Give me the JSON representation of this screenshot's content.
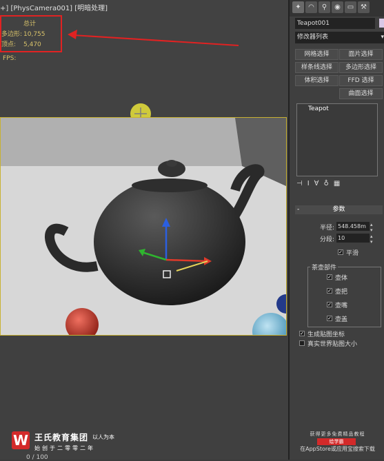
{
  "viewport": {
    "label": "+] [PhysCamera001] [明暗处理]",
    "stats": {
      "header": "总计",
      "polygons_label": "多边形:",
      "polygons_value": "10,755",
      "vertices_label": "顶点:",
      "vertices_value": "5,470"
    },
    "fps_label": "FPS:"
  },
  "branding": {
    "logo_letter": "W",
    "company": "王氏教育集团",
    "slogan": "以人为本",
    "founded": "始创于二零零二年",
    "page_counter": "0 / 100"
  },
  "panel": {
    "tabs": [
      "✦",
      "◠",
      "⚲",
      "◉",
      "▭",
      "⚒"
    ],
    "object_name": "Teapot001",
    "modifier_list": "修改器列表",
    "buttons": [
      "网格选择",
      "面片选择",
      "样条线选择",
      "多边形选择",
      "体积选择",
      "FFD 选择",
      "曲面选择"
    ],
    "stack_item": "Teapot",
    "stack_tools": [
      "⊣",
      "I",
      "∀",
      "♁",
      "▦"
    ],
    "rollout_title": "参数",
    "radius_label": "半径:",
    "radius_value": "548.458m",
    "segments_label": "分段:",
    "segments_value": "10",
    "smooth_label": "平滑",
    "parts_title": "茶壶部件",
    "parts": [
      "壶体",
      "壶把",
      "壶嘴",
      "壶盖"
    ],
    "gen_mapping_label": "生成贴图坐标",
    "real_world_label": "真实世界贴图大小"
  },
  "promo": {
    "line1": "获得更多免费精品教程",
    "badge": "绘学霸",
    "line2": "在AppStore或应用宝搜索下载"
  },
  "colors": {
    "annotation": "#e12222",
    "stats_text": "#d9c36a",
    "viewport_border": "#c8b232",
    "gizmo": "#e8e23a"
  }
}
